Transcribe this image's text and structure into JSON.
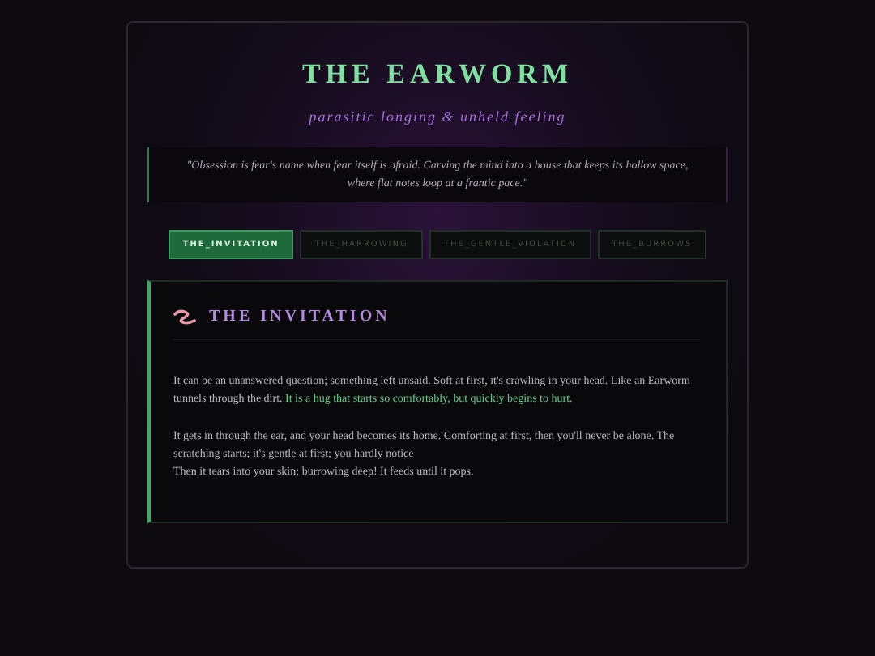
{
  "header": {
    "title": "THE EARWORM",
    "subtitle": "parasitic longing & unheld feeling"
  },
  "quote": "\"Obsession is fear's name when fear itself is afraid. Carving the mind into a house that keeps its hollow space, where flat notes loop at a frantic pace.\"",
  "tabs": [
    {
      "label": "THE_INVITATION",
      "selected": true
    },
    {
      "label": "THE_HARROWING",
      "selected": false
    },
    {
      "label": "THE_GENTLE_VIOLATION",
      "selected": false
    },
    {
      "label": "THE_BURROWS",
      "selected": false
    }
  ],
  "section": {
    "title": "THE INVITATION",
    "paragraphs": [
      {
        "lines": [
          [
            {
              "kind": "plain",
              "text": "It can be an unanswered question; something left unsaid. Soft at first, it's crawling in your head. Like an Earworm tunnels through the dirt. "
            },
            {
              "kind": "highlight",
              "text": "It is a hug that starts so comfortably, but quickly begins to hurt."
            }
          ]
        ]
      },
      {
        "lines": [
          [
            {
              "kind": "plain",
              "text": "It gets in through the ear, and your head becomes its home. Comforting at first, then you'll never be alone. The scratching starts; it's gentle at first; you hardly notice"
            }
          ],
          [
            {
              "kind": "plain",
              "text": "Then it tears into your skin; burrowing deep! It feeds until it pops."
            }
          ]
        ]
      }
    ]
  }
}
